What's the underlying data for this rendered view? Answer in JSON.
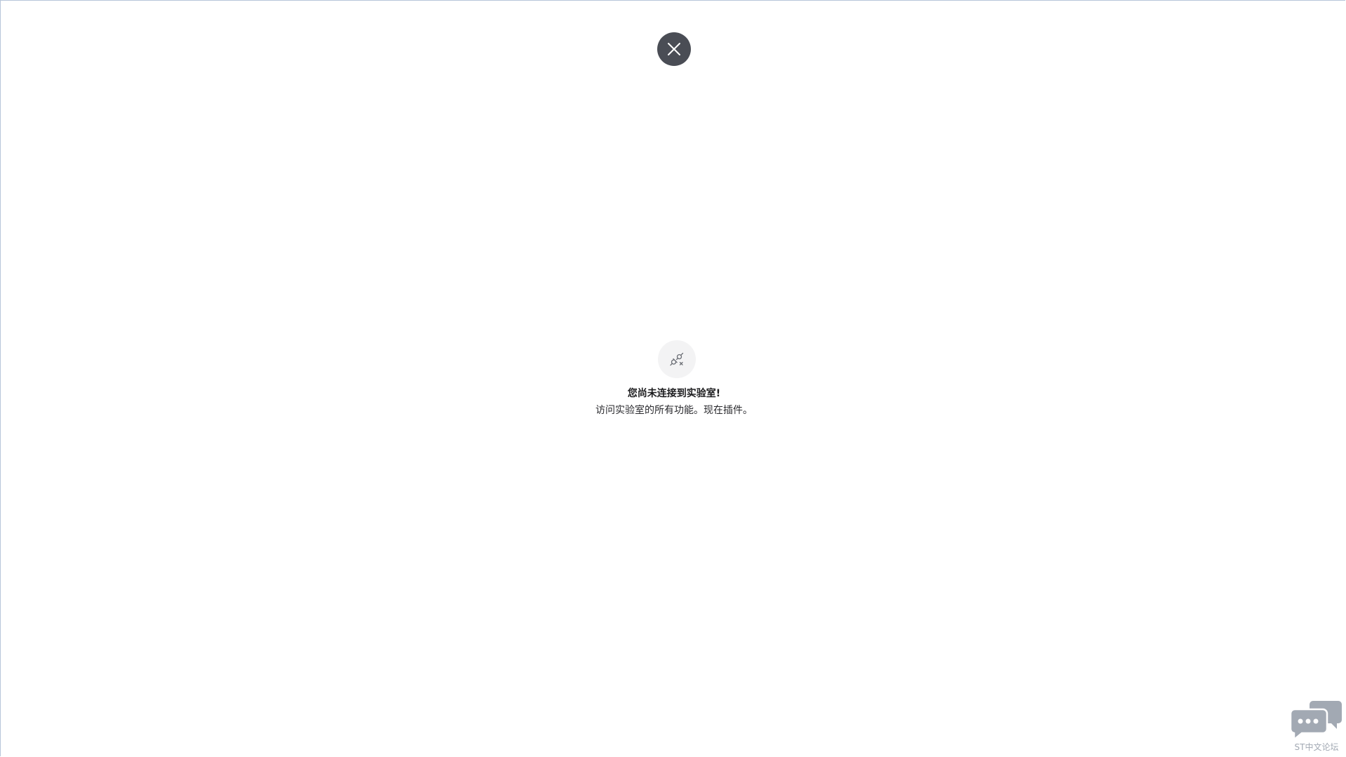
{
  "close_button": {
    "icon": "close-icon",
    "color": "#4a4d55"
  },
  "empty_state": {
    "icon": "unplugged-icon",
    "title": "您尚未连接到实验室!",
    "subtitle": "访问实验室的所有功能。现在插件。"
  },
  "forum_badge": {
    "icon": "chat-bubbles-icon",
    "label": "ST中文论坛",
    "color": "#a2a9b3"
  }
}
